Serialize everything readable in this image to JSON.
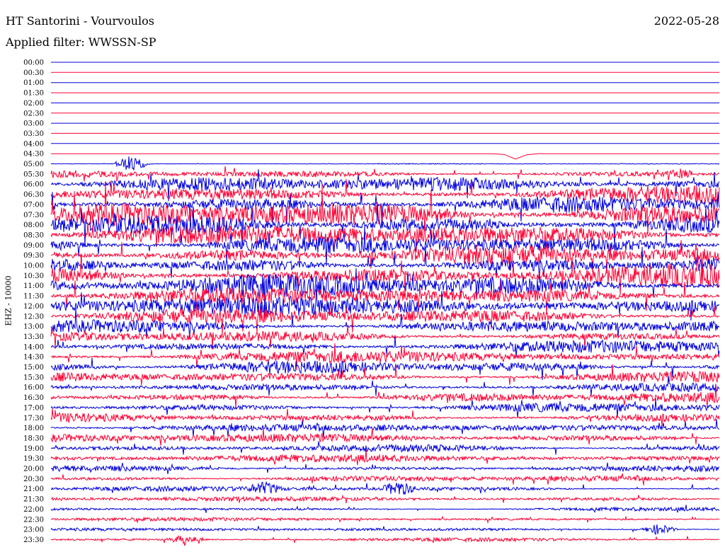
{
  "header": {
    "station": "HT Santorini - Vourvoulos",
    "date": "2022-05-28",
    "filter": "Applied filter: WWSSN-SP"
  },
  "chart_data": {
    "type": "line",
    "title": "HT Santorini - Vourvoulos",
    "ylabel": "EHZ - 10000",
    "row_labels": [
      "00:00",
      "00:30",
      "01:00",
      "01:30",
      "02:00",
      "02:30",
      "03:00",
      "03:30",
      "04:00",
      "04:30",
      "05:00",
      "05:30",
      "06:00",
      "06:30",
      "07:00",
      "07:30",
      "08:00",
      "08:30",
      "09:00",
      "09:30",
      "10:00",
      "10:30",
      "11:00",
      "11:30",
      "12:00",
      "12:30",
      "13:00",
      "13:30",
      "14:00",
      "14:30",
      "15:00",
      "15:30",
      "16:00",
      "16:30",
      "17:00",
      "17:30",
      "18:00",
      "18:30",
      "19:00",
      "19:30",
      "20:00",
      "20:30",
      "21:00",
      "21:30",
      "22:00",
      "22:30",
      "23:00",
      "23:30"
    ],
    "colors": [
      "#0000dd",
      "#ff0033"
    ],
    "amplitude": [
      0,
      0,
      0,
      0,
      0,
      0,
      0,
      0,
      0,
      0,
      0.6,
      6,
      10,
      14,
      16,
      18,
      18,
      16,
      14,
      14,
      14,
      16,
      16,
      14,
      13,
      11,
      10,
      9,
      9,
      9,
      9,
      8,
      8,
      7,
      7,
      7,
      6,
      6,
      5,
      5,
      4,
      4,
      3.5,
      3,
      2.5,
      2.5,
      2.5,
      2.5
    ],
    "events": [
      {
        "row": 10,
        "pos": 0.12,
        "amp": 12
      },
      {
        "row": 9,
        "pos": 0.7,
        "amp": 10
      },
      {
        "row": 11,
        "pos": 0.94,
        "amp": 6
      },
      {
        "row": 42,
        "pos": 0.32,
        "amp": 8
      },
      {
        "row": 42,
        "pos": 0.52,
        "amp": 10
      },
      {
        "row": 46,
        "pos": 0.91,
        "amp": 8
      },
      {
        "row": 47,
        "pos": 0.2,
        "amp": 6
      }
    ]
  }
}
